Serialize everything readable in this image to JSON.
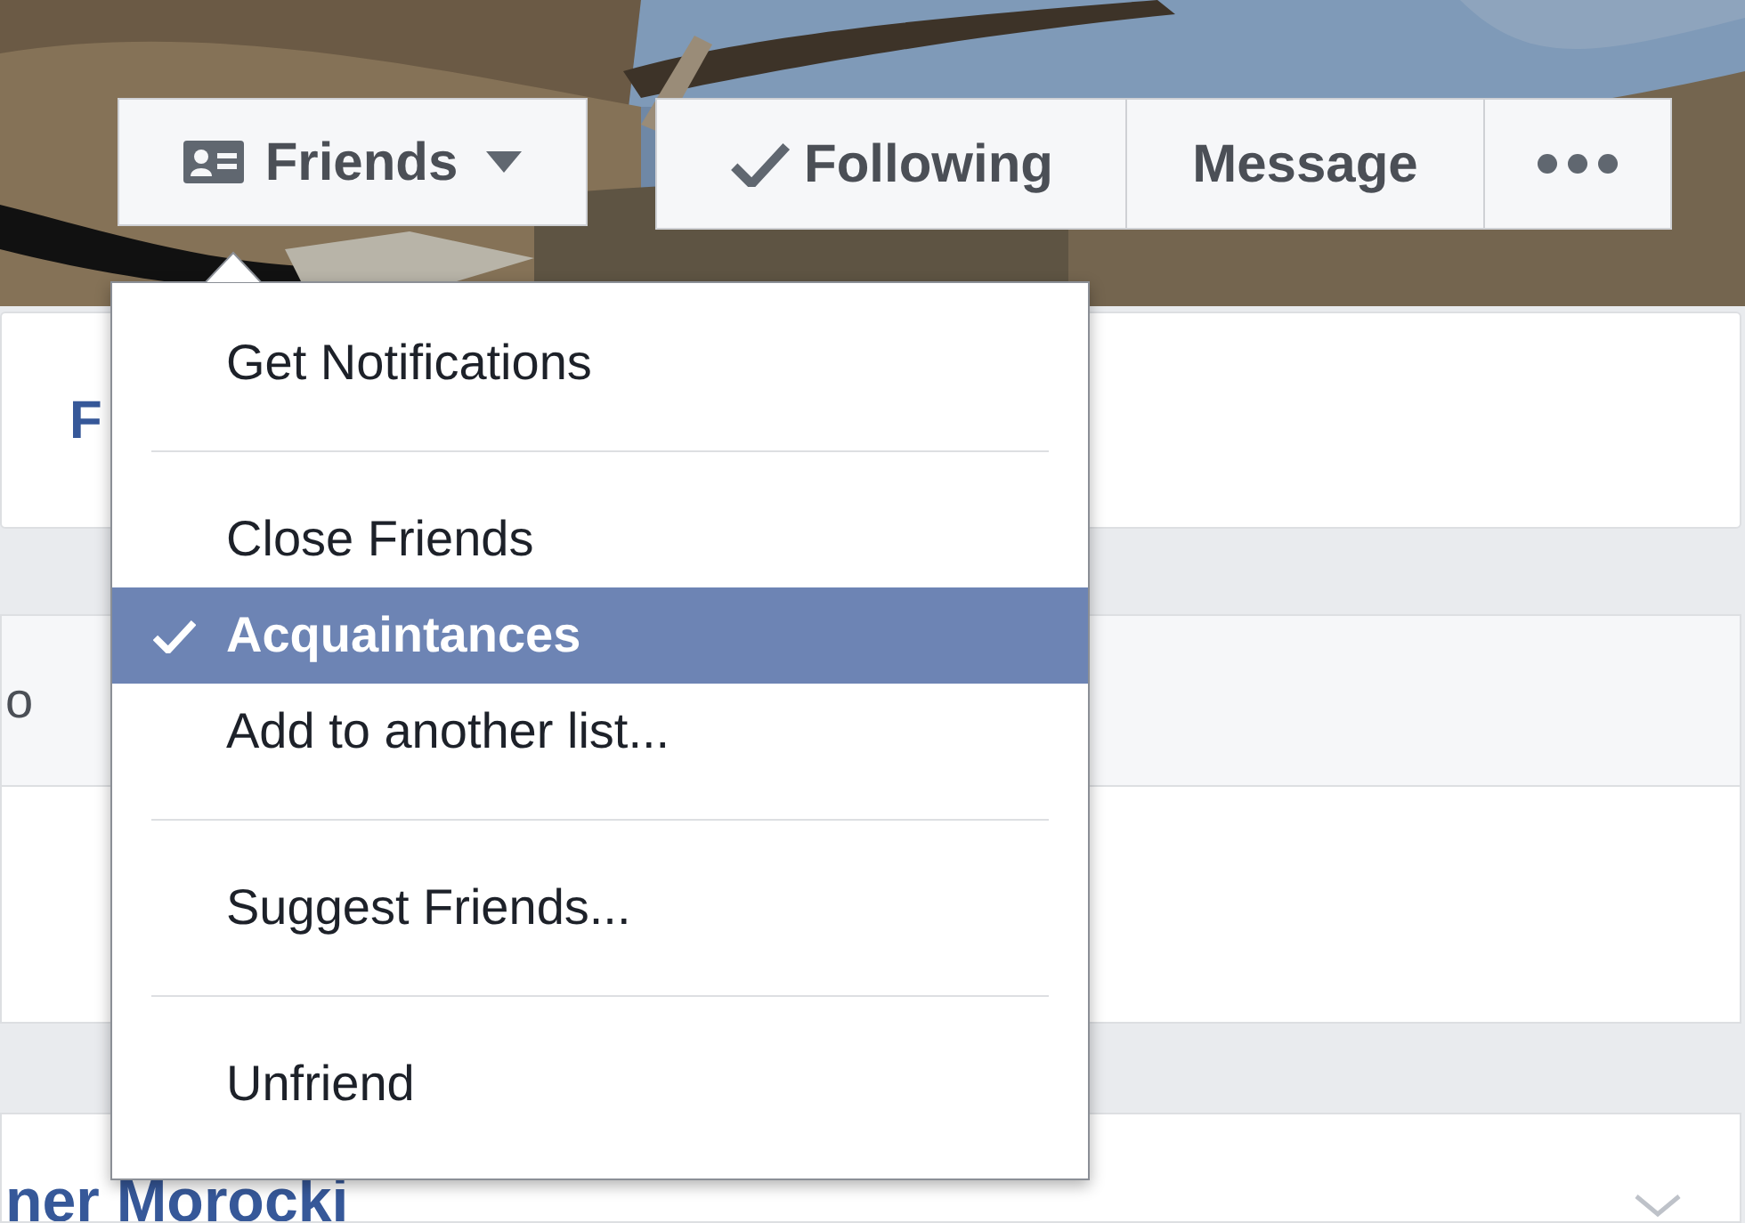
{
  "profile_actions": {
    "friends_button": {
      "label": "Friends",
      "open": true
    },
    "buttons": [
      {
        "kind": "toggle",
        "label": "Following",
        "checked": true
      },
      {
        "kind": "plain",
        "label": "Message"
      },
      {
        "kind": "more"
      }
    ]
  },
  "background_cards": [
    {
      "kind": "title",
      "text": "F"
    },
    {
      "kind": "gray",
      "text": "o"
    },
    {
      "kind": "plain"
    },
    {
      "kind": "name",
      "text": "ner Morocki"
    }
  ],
  "menu": {
    "items": [
      {
        "kind": "item",
        "label": "Get Notifications",
        "checked": false,
        "selected": false
      },
      {
        "kind": "separator"
      },
      {
        "kind": "item",
        "label": "Close Friends",
        "checked": false,
        "selected": false
      },
      {
        "kind": "item",
        "label": "Acquaintances",
        "checked": true,
        "selected": true
      },
      {
        "kind": "item",
        "label": "Add to another list...",
        "checked": false,
        "selected": false
      },
      {
        "kind": "separator"
      },
      {
        "kind": "item",
        "label": "Suggest Friends...",
        "checked": false,
        "selected": false
      },
      {
        "kind": "separator"
      },
      {
        "kind": "item",
        "label": "Unfriend",
        "checked": false,
        "selected": false
      }
    ]
  }
}
